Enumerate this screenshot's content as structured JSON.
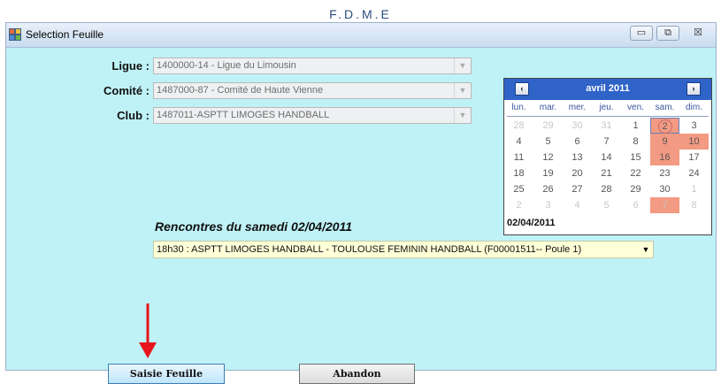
{
  "app_header": "F.D.M.E",
  "window": {
    "title": "Selection Feuille",
    "controls": {
      "minimize": "▭",
      "maximize": "⧉",
      "close": "☒"
    }
  },
  "form": {
    "ligue": {
      "label": "Ligue :",
      "value": "1400000-14 - Ligue du Limousin"
    },
    "comite": {
      "label": "Comité :",
      "value": "1487000-87 - Comité de Haute Vienne"
    },
    "club": {
      "label": "Club :",
      "value": "1487011-ASPTT LIMOGES HANDBALL"
    }
  },
  "calendar": {
    "month_label": "avril 2011",
    "prev": "‹",
    "next": "›",
    "weekdays": [
      "lun.",
      "mar.",
      "mer.",
      "jeu.",
      "ven.",
      "sam.",
      "dim."
    ],
    "weeks": [
      [
        "28",
        "29",
        "30",
        "31",
        "1",
        "2",
        "3"
      ],
      [
        "4",
        "5",
        "6",
        "7",
        "8",
        "9",
        "10"
      ],
      [
        "11",
        "12",
        "13",
        "14",
        "15",
        "16",
        "17"
      ],
      [
        "18",
        "19",
        "20",
        "21",
        "22",
        "23",
        "24"
      ],
      [
        "25",
        "26",
        "27",
        "28",
        "29",
        "30",
        "1"
      ],
      [
        "2",
        "3",
        "4",
        "5",
        "6",
        "7",
        "8"
      ]
    ],
    "other_month_cells": [
      "0-0",
      "0-1",
      "0-2",
      "0-3",
      "4-6",
      "5-0",
      "5-1",
      "5-2",
      "5-3",
      "5-4",
      "5-5",
      "5-6"
    ],
    "highlighted_cells": [
      "0-5",
      "1-5",
      "1-6",
      "2-5",
      "5-5"
    ],
    "today_cell": "0-5",
    "footer_date": "02/04/2011",
    "highlight_color": "#f39a82"
  },
  "matches": {
    "heading": "Rencontres du samedi  02/04/2011",
    "selected": "18h30 :  ASPTT LIMOGES HANDBALL - TOULOUSE FEMININ HANDBALL (F00001511-- Poule 1)"
  },
  "buttons": {
    "saisie": "Saisie Feuille",
    "abandon": "Abandon"
  },
  "icons": {
    "dropdown": "▼",
    "annotation_arrow": "red-arrow-down"
  }
}
